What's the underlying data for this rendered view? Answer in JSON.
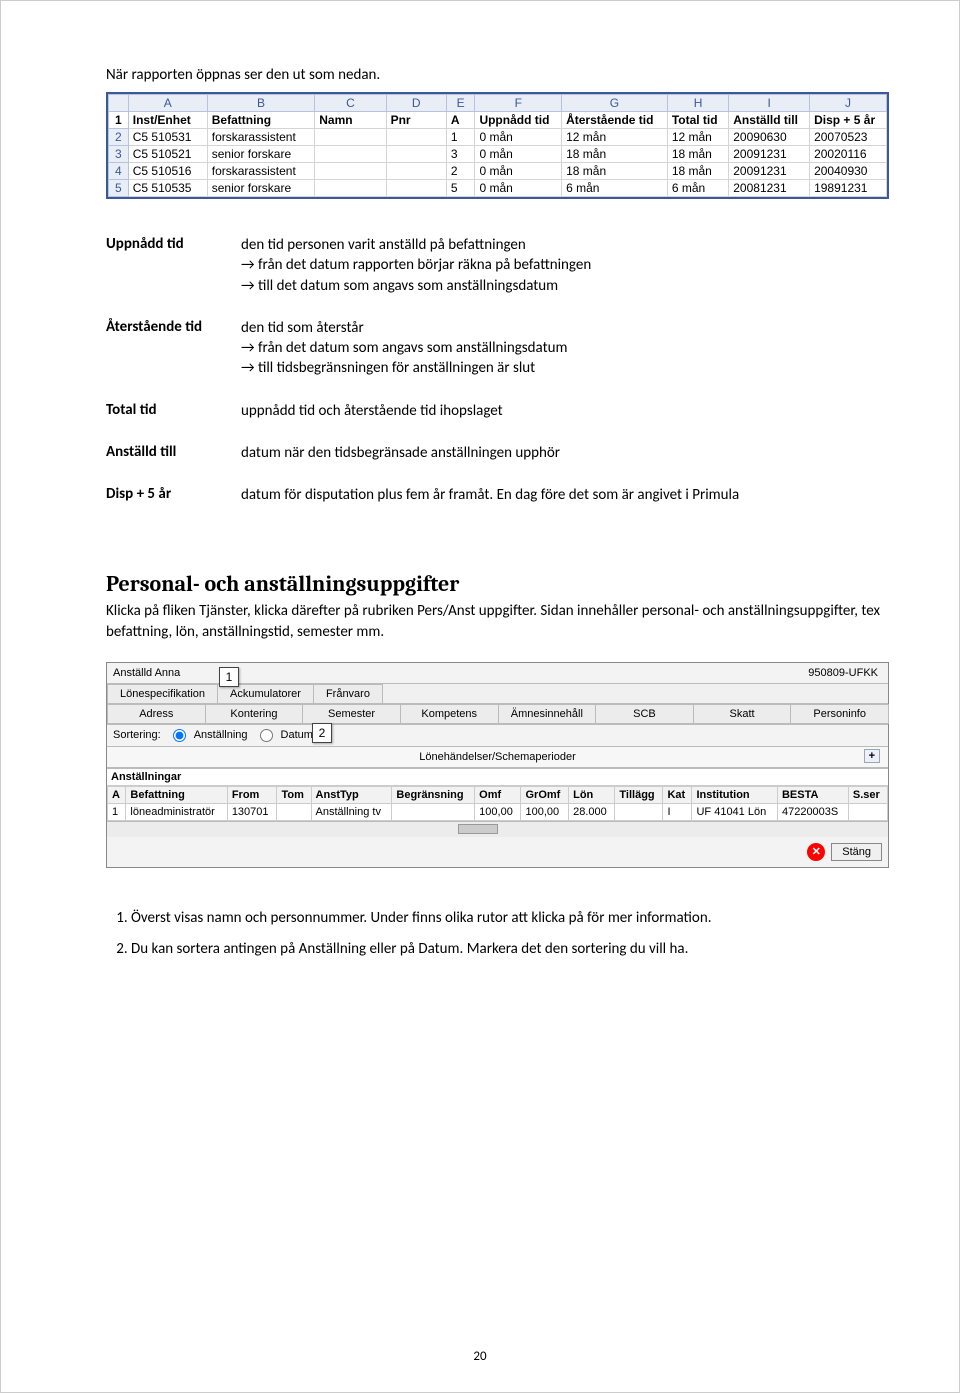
{
  "intro": "När rapporten öppnas ser den ut som nedan.",
  "excel": {
    "col_letters": [
      "A",
      "B",
      "C",
      "D",
      "E",
      "F",
      "G",
      "H",
      "I",
      "J"
    ],
    "header": [
      "Inst/Enhet",
      "Befattning",
      "Namn",
      "Pnr",
      "A",
      "Uppnådd tid",
      "Återstående tid",
      "Total tid",
      "Anställd till",
      "Disp + 5 år"
    ],
    "rows": [
      [
        "C5 510531",
        "forskarassistent",
        "",
        "",
        "1",
        "0 mån",
        "12 mån",
        "12 mån",
        "20090630",
        "20070523"
      ],
      [
        "C5 510521",
        "senior forskare",
        "",
        "",
        "3",
        "0 mån",
        "18 mån",
        "18 mån",
        "20091231",
        "20020116"
      ],
      [
        "C5 510516",
        "forskarassistent",
        "",
        "",
        "2",
        "0 mån",
        "18 mån",
        "18 mån",
        "20091231",
        "20040930"
      ],
      [
        "C5 510535",
        "senior forskare",
        "",
        "",
        "5",
        "0 mån",
        "6 mån",
        "6 mån",
        "20081231",
        "19891231"
      ]
    ]
  },
  "defs": [
    {
      "k": "Uppnådd tid",
      "v": "den tid personen varit anställd på befattningen\n→ från det datum rapporten börjar räkna på befattningen\n→ till det datum som angavs som anställningsdatum"
    },
    {
      "k": "Återstående tid",
      "v": "den tid som återstår\n→ från det datum som angavs som anställningsdatum\n→ till tidsbegränsningen för anställningen är slut"
    },
    {
      "k": "Total tid",
      "v": "uppnådd tid och återstående tid ihopslaget"
    },
    {
      "k": "Anställd till",
      "v": "datum när den tidsbegränsade anställningen upphör"
    },
    {
      "k": "Disp + 5 år",
      "v": "datum för disputation plus fem år framåt. En dag före det som är angivet i Primula"
    }
  ],
  "section2_title": "Personal- och anställningsuppgifter",
  "section2_body": "Klicka på fliken Tjänster, klicka därefter på rubriken Pers/Anst uppgifter. Sidan innehåller personal- och anställningsuppgifter, tex befattning, lön, anställningstid, semester mm.",
  "primula": {
    "name": "Anställd Anna",
    "pnr": "950809-UFKK",
    "tabs_row1": [
      "Lönespecifikation",
      "Ackumulatorer",
      "Frånvaro"
    ],
    "tabs_row2": [
      "Adress",
      "Kontering",
      "Semester",
      "Kompetens",
      "Ämnesinnehåll",
      "SCB",
      "Skatt",
      "Personinfo"
    ],
    "sort_label": "Sortering:",
    "sort_opt1": "Anställning",
    "sort_opt2": "Datum",
    "mid_header": "Lönehändelser/Schemaperioder",
    "grid_section": "Anställningar",
    "grid_headers": [
      "A",
      "Befattning",
      "From",
      "Tom",
      "AnstTyp",
      "Begränsning",
      "Omf",
      "GrOmf",
      "Lön",
      "Tillägg",
      "Kat",
      "Institution",
      "BESTA",
      "S.ser"
    ],
    "grid_row": [
      "1",
      "löneadministratör",
      "130701",
      "",
      "Anställning tv",
      "",
      "100,00",
      "100,00",
      "28.000",
      "",
      "I",
      "UF 41041 Lön",
      "47220003S",
      ""
    ],
    "close_label": "Stäng",
    "callout1": "1",
    "callout2": "2"
  },
  "notes": [
    "Överst visas namn och personnummer. Under finns olika rutor att klicka på för mer information.",
    "Du kan sortera antingen på Anställning eller på Datum. Markera det den sortering du vill ha."
  ],
  "page_number": "20"
}
